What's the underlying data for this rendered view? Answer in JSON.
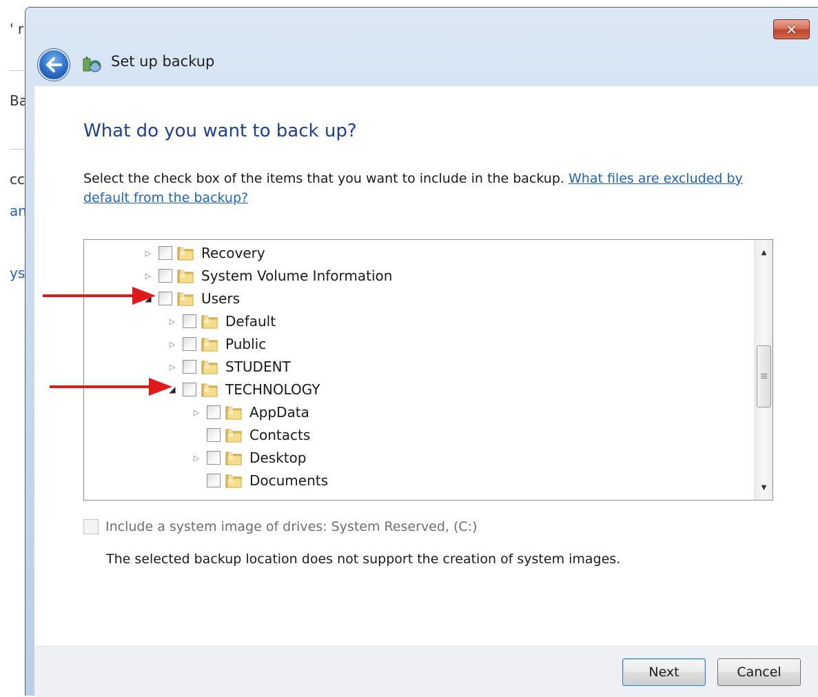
{
  "background_window": {
    "fragments": [
      "' r",
      "Ba",
      "cc",
      "an",
      "ys"
    ]
  },
  "window": {
    "title": "Set up backup",
    "close_label": "✕"
  },
  "page": {
    "heading": "What do you want to back up?",
    "instruction": "Select the check box of the items that you want to include in the backup.",
    "help_link": "What files are excluded by default from the backup?"
  },
  "tree": {
    "items": [
      {
        "label": "Recovery",
        "level": 0,
        "expander": "collapsed",
        "checked": false
      },
      {
        "label": "System Volume Information",
        "level": 0,
        "expander": "collapsed",
        "checked": false
      },
      {
        "label": "Users",
        "level": 0,
        "expander": "expanded",
        "checked": false
      },
      {
        "label": "Default",
        "level": 1,
        "expander": "collapsed",
        "checked": false
      },
      {
        "label": "Public",
        "level": 1,
        "expander": "collapsed",
        "checked": false
      },
      {
        "label": "STUDENT",
        "level": 1,
        "expander": "collapsed",
        "checked": false
      },
      {
        "label": "TECHNOLOGY",
        "level": 1,
        "expander": "expanded",
        "checked": false
      },
      {
        "label": "AppData",
        "level": 2,
        "expander": "collapsed",
        "checked": false
      },
      {
        "label": "Contacts",
        "level": 2,
        "expander": "none",
        "checked": false
      },
      {
        "label": "Desktop",
        "level": 2,
        "expander": "collapsed",
        "checked": false
      },
      {
        "label": "Documents",
        "level": 2,
        "expander": "none",
        "checked": false
      }
    ]
  },
  "system_image": {
    "label": "Include a system image of drives: System Reserved, (C:)",
    "checked": false,
    "enabled": false,
    "note": "The selected backup location does not support the creation of system images."
  },
  "footer": {
    "next_label": "Next",
    "cancel_label": "Cancel"
  },
  "colors": {
    "heading": "#1e3f98",
    "link": "#1f63c4",
    "annotation_arrow": "#e01a1a"
  },
  "annotations": [
    "red-arrow",
    "red-arrow"
  ]
}
